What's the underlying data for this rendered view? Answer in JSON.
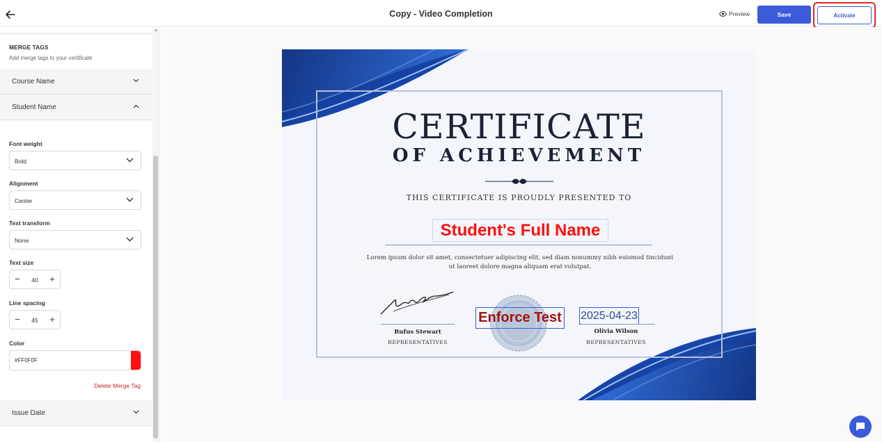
{
  "header": {
    "title": "Copy - Video Completion",
    "preview_label": "Preview",
    "save_label": "Save",
    "activate_label": "Activate"
  },
  "sidebar": {
    "section_title": "MERGE TAGS",
    "section_subtitle": "Add merge tags to your certificate",
    "accordions": [
      {
        "label": "Course Name"
      },
      {
        "label": "Student Name"
      },
      {
        "label": "Issue Date"
      }
    ],
    "font_weight": {
      "label": "Font weight",
      "value": "Bold"
    },
    "alignment": {
      "label": "Alignment",
      "value": "Center"
    },
    "text_transform": {
      "label": "Text transform",
      "value": "None"
    },
    "text_size": {
      "label": "Text size",
      "value": "40"
    },
    "line_spacing": {
      "label": "Line spacing",
      "value": "45"
    },
    "color": {
      "label": "Color",
      "value": "#FF0F0F"
    },
    "delete_label": "Delete Merge Tag"
  },
  "certificate": {
    "title": "CERTIFICATE",
    "subtitle": "OF ACHIEVEMENT",
    "presented_to": "THIS CERTIFICATE IS PROUDLY PRESENTED TO",
    "student_name": "Student's Full Name",
    "body_line1": "Lorem ipsum dolor sit amet, consectetuer adipiscing elit, sed diam nonummy nibh euismod tincidunt",
    "body_line2": "ut laoreet dolore magna aliquam erat volutpat.",
    "signer_left_name": "Rufus Stewart",
    "signer_left_role": "REPRESENTATIVES",
    "signer_right_name": "Olivia Wilson",
    "signer_right_role": "REPRESENTATIVES",
    "course_tag": "Enforce Test",
    "issue_date": "2025-04-23"
  },
  "colors": {
    "accent": "#3b5bdb",
    "highlight": "#e02424",
    "merge_tag_color": "#FF0F0F"
  }
}
